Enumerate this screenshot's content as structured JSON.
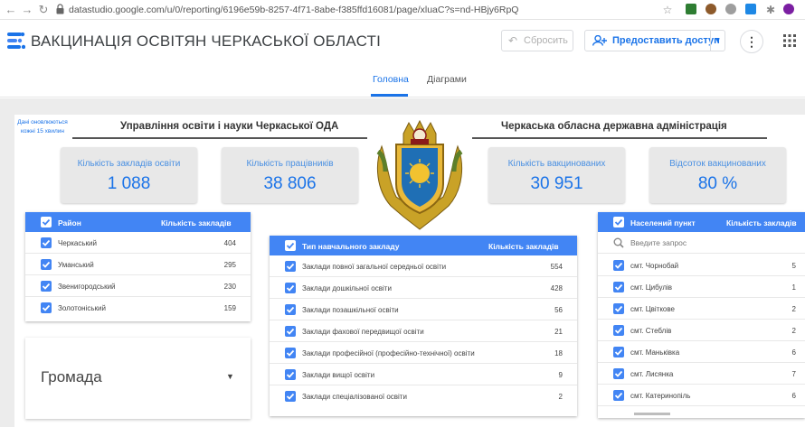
{
  "browser": {
    "url": "datastudio.google.com/u/0/reporting/6196e59b-8257-4f71-8abe-f385ffd16081/page/xluaC?s=nd-HBjy6RpQ"
  },
  "header": {
    "title": "ВАКЦИНАЦІЯ ОСВІТЯН ЧЕРКАСЬКОЇ ОБЛАСТІ",
    "reset_label": "Сбросить",
    "share_label": "Предоставить доступ"
  },
  "tabs": [
    {
      "label": "Головна",
      "active": true
    },
    {
      "label": "Діаграми",
      "active": false
    }
  ],
  "note": "Дані оновлюються кожні 15 хвилин",
  "sections": {
    "left": "Управління освіти і науки Черкаської ОДА",
    "right": "Черкаська обласна державна адміністрація"
  },
  "kpis": [
    {
      "label": "Кількість закладів освіти",
      "value": "1 088"
    },
    {
      "label": "Кількість працівників",
      "value": "38 806"
    },
    {
      "label": "Кількість вакцинованих",
      "value": "30 951"
    },
    {
      "label": "Відсоток вакцинованих",
      "value": "80 %"
    }
  ],
  "district_table": {
    "col1": "Район",
    "col2": "Кількість закладів",
    "rows": [
      {
        "name": "Черкаський",
        "count": "404"
      },
      {
        "name": "Уманський",
        "count": "295"
      },
      {
        "name": "Звенигородський",
        "count": "230"
      },
      {
        "name": "Золотоніський",
        "count": "159"
      }
    ]
  },
  "gromada": {
    "label": "Громада"
  },
  "type_table": {
    "col1": "Тип навчального закладу",
    "col2": "Кількість закладів",
    "rows": [
      {
        "name": "Заклади повної загальної середньої освіти",
        "count": "554"
      },
      {
        "name": "Заклади дошкільної освіти",
        "count": "428"
      },
      {
        "name": "Заклади позашкільної освіти",
        "count": "56"
      },
      {
        "name": "Заклади фахової передвищої освіти",
        "count": "21"
      },
      {
        "name": "Заклади професійної (професійно-технічної) освіти",
        "count": "18"
      },
      {
        "name": "Заклади вищої освіти",
        "count": "9"
      },
      {
        "name": "Заклади спеціалізованої освіти",
        "count": "2"
      }
    ]
  },
  "settlement_table": {
    "col1": "Населений пункт",
    "col2": "Кількість закладів",
    "search_placeholder": "Введите запрос",
    "rows": [
      {
        "name": "смт. Чорнобай",
        "count": "5"
      },
      {
        "name": "смт. Цибулів",
        "count": "1"
      },
      {
        "name": "смт. Цвіткове",
        "count": "2"
      },
      {
        "name": "смт. Стеблів",
        "count": "2"
      },
      {
        "name": "смт. Маньківка",
        "count": "6"
      },
      {
        "name": "смт. Лисянка",
        "count": "7"
      },
      {
        "name": "смт. Катеринопіль",
        "count": "6"
      }
    ]
  },
  "colors": {
    "accent": "#1a73e8",
    "table_header": "#4285f4",
    "kpi_bg": "#e8e8e8"
  }
}
